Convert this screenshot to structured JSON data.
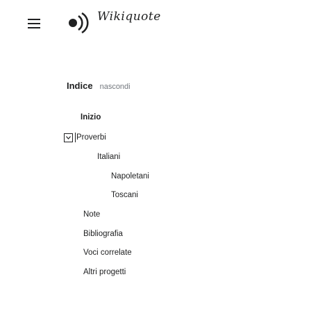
{
  "header": {
    "menu_icon": "hamburger-menu-icon",
    "logo_icon": "radio-waves-logo-icon",
    "logo_text": "Wikiquote"
  },
  "toc": {
    "title": "Indice",
    "hide_label": "nascondi",
    "items": [
      {
        "label": "Inizio",
        "level": 0,
        "bold": true
      },
      {
        "label": "Proverbi",
        "level": 0,
        "bold": false,
        "expanded": true
      },
      {
        "label": "Italiani",
        "level": 1,
        "bold": false
      },
      {
        "label": "Napoletani",
        "level": 2,
        "bold": false
      },
      {
        "label": "Toscani",
        "level": 2,
        "bold": false
      },
      {
        "label": "Note",
        "level": 0,
        "bold": false
      },
      {
        "label": "Bibliografia",
        "level": 0,
        "bold": false
      },
      {
        "label": "Voci correlate",
        "level": 0,
        "bold": false
      },
      {
        "label": "Altri progetti",
        "level": 0,
        "bold": false
      }
    ],
    "toggle_icon": "chevron-down-icon"
  }
}
